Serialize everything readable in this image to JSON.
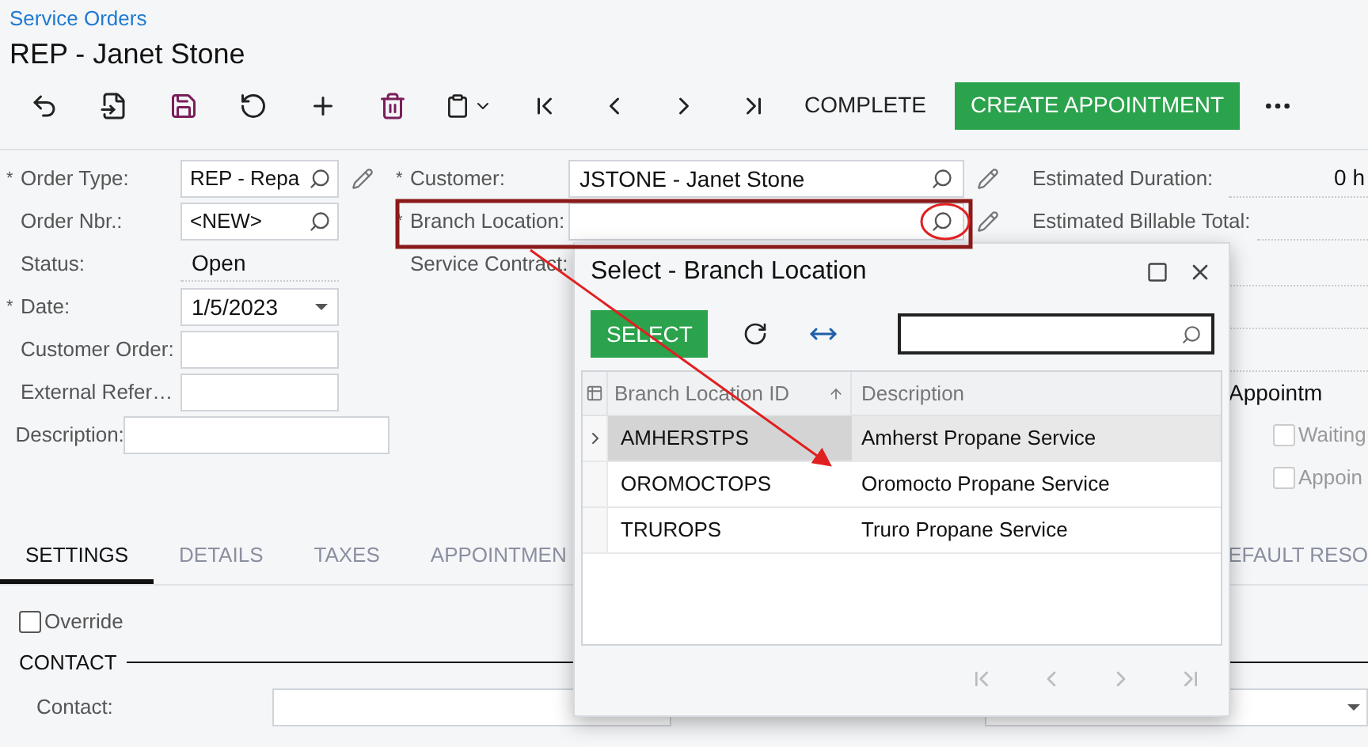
{
  "breadcrumb": "Service Orders",
  "title": "REP - Janet Stone",
  "toolbar": {
    "actions": [
      {
        "label": "COMPLETE",
        "kind": "text"
      },
      {
        "label": "CREATE APPOINTMENT",
        "kind": "primary"
      }
    ]
  },
  "form": {
    "required_mark": "*",
    "left": [
      {
        "label": "Order Type:",
        "required": true,
        "kind": "lookup",
        "value": "REP - Repa",
        "editable": true
      },
      {
        "label": "Order Nbr.:",
        "required": false,
        "kind": "lookup",
        "value": "<NEW>",
        "editable": false
      },
      {
        "label": "Status:",
        "required": false,
        "kind": "readonly",
        "value": "Open"
      },
      {
        "label": "Date:",
        "required": true,
        "kind": "date",
        "value": "1/5/2023"
      },
      {
        "label": "Customer Order:",
        "required": false,
        "kind": "input"
      },
      {
        "label": "External Refer…",
        "required": false,
        "kind": "input"
      },
      {
        "label": "Description:",
        "required": false,
        "kind": "wide"
      }
    ],
    "center": [
      {
        "label": "Customer:",
        "required": true,
        "kind": "lookup",
        "value": "JSTONE - Janet Stone",
        "highlighted": false
      },
      {
        "label": "Branch Location:",
        "required": true,
        "kind": "lookup",
        "highlighted": true
      },
      {
        "label": "Service Contract:",
        "required": false,
        "kind": "hidden",
        "highlighted": false
      }
    ],
    "right": [
      {
        "kind": "value",
        "label": "Estimated Duration:",
        "value": "0 h"
      },
      {
        "kind": "value",
        "label": "Estimated Billable Total:"
      },
      {
        "kind": "blank"
      },
      {
        "kind": "blank"
      },
      {
        "kind": "blank"
      },
      {
        "kind": "text",
        "value": "Appointm"
      },
      {
        "kind": "checkbox",
        "label": "Waiting",
        "checked": false
      },
      {
        "kind": "checkbox",
        "label": "Appoin",
        "checked": false
      }
    ]
  },
  "tabs": [
    {
      "label": "SETTINGS",
      "selected": true
    },
    {
      "label": "DETAILS",
      "selected": false
    },
    {
      "label": "TAXES",
      "selected": false
    },
    {
      "label": "APPOINTMEN",
      "selected": false
    },
    {
      "label": "EFAULT RESO",
      "selected": false
    }
  ],
  "settings": {
    "override": {
      "label": "Override",
      "checked": false
    },
    "section": "CONTACT",
    "contact_label": "Contact:"
  },
  "dialog": {
    "title": "Select - Branch Location",
    "select_button": "SELECT",
    "columns": [
      {
        "label": "Branch Location ID",
        "sorted": true
      },
      {
        "label": "Description",
        "sorted": false
      }
    ],
    "rows": [
      {
        "id": "AMHERSTPS",
        "description": "Amherst Propane Service",
        "selected": true
      },
      {
        "id": "OROMOCTOPS",
        "description": "Oromocto Propane Service",
        "selected": false
      },
      {
        "id": "TRUROPS",
        "description": "Truro Propane Service",
        "selected": false
      }
    ]
  }
}
